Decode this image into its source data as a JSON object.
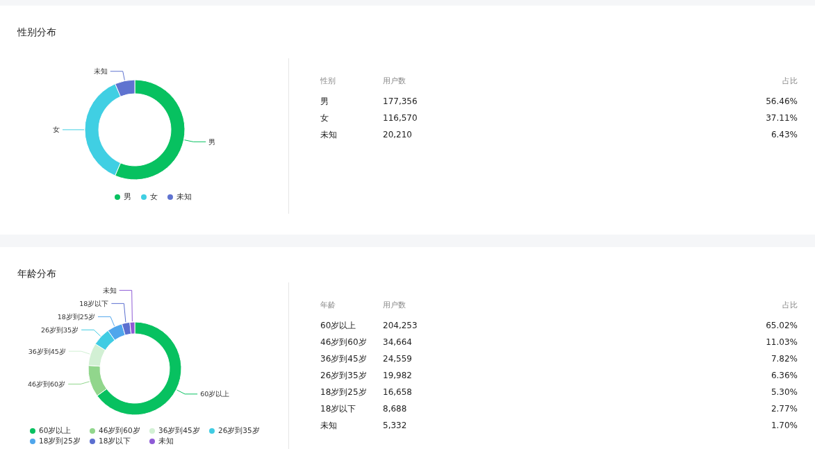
{
  "gender": {
    "title": "性别分布",
    "chart_data": {
      "type": "donut",
      "categories": [
        "男",
        "女",
        "未知"
      ],
      "values": [
        56.46,
        37.11,
        6.43
      ]
    },
    "legend": [
      {
        "label": "男",
        "color": "#07c160"
      },
      {
        "label": "女",
        "color": "#40cfe3"
      },
      {
        "label": "未知",
        "color": "#5f73d0"
      }
    ],
    "table": {
      "columns": [
        "性别",
        "用户数",
        "占比"
      ],
      "rows": [
        [
          "男",
          "177,356",
          "56.46%"
        ],
        [
          "女",
          "116,570",
          "37.11%"
        ],
        [
          "未知",
          "20,210",
          "6.43%"
        ]
      ]
    }
  },
  "age": {
    "title": "年龄分布",
    "chart_data": {
      "type": "donut",
      "categories": [
        "60岁以上",
        "46岁到60岁",
        "36岁到45岁",
        "26岁到35岁",
        "18岁到25岁",
        "18岁以下",
        "未知"
      ],
      "values": [
        65.02,
        11.03,
        7.82,
        6.36,
        5.3,
        2.77,
        1.7
      ]
    },
    "legend": [
      {
        "label": "60岁以上",
        "color": "#07c160"
      },
      {
        "label": "46岁到60岁",
        "color": "#91d68c"
      },
      {
        "label": "36岁到45岁",
        "color": "#d2f0d4"
      },
      {
        "label": "26岁到35岁",
        "color": "#40cce3"
      },
      {
        "label": "18岁到25岁",
        "color": "#4fa6ec"
      },
      {
        "label": "18岁以下",
        "color": "#5b6fd0"
      },
      {
        "label": "未知",
        "color": "#8e5bd6"
      }
    ],
    "table": {
      "columns": [
        "年龄",
        "用户数",
        "占比"
      ],
      "rows": [
        [
          "60岁以上",
          "204,253",
          "65.02%"
        ],
        [
          "46岁到60岁",
          "34,664",
          "11.03%"
        ],
        [
          "36岁到45岁",
          "24,559",
          "7.82%"
        ],
        [
          "26岁到35岁",
          "19,982",
          "6.36%"
        ],
        [
          "18岁到25岁",
          "16,658",
          "5.30%"
        ],
        [
          "18岁以下",
          "8,688",
          "2.77%"
        ],
        [
          "未知",
          "5,332",
          "1.70%"
        ]
      ]
    }
  }
}
